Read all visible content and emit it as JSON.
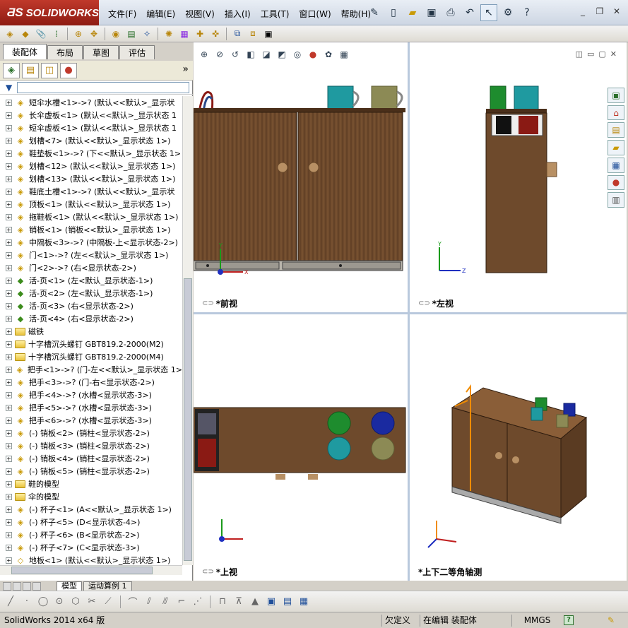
{
  "app": {
    "logo": "SOLIDWORKS",
    "menu": [
      "文件(F)",
      "编辑(E)",
      "视图(V)",
      "插入(I)",
      "工具(T)",
      "窗口(W)",
      "帮助(H)"
    ]
  },
  "left_panel": {
    "tabs": [
      "装配体",
      "布局",
      "草图",
      "评估"
    ],
    "active_tab": "装配体",
    "tree": [
      {
        "type": "asm",
        "label": "短伞水槽<1>->? (默认<<默认>_显示状"
      },
      {
        "type": "asm",
        "label": "长伞虚板<1> (默认<<默认>_显示状态 1"
      },
      {
        "type": "asm",
        "label": "短伞虚板<1> (默认<<默认>_显示状态 1"
      },
      {
        "type": "asm",
        "label": "划槽<7> (默认<<默认>_显示状态 1>)"
      },
      {
        "type": "asm",
        "label": "鞋垫板<1>->? (下<<默认>_显示状态 1>"
      },
      {
        "type": "asm",
        "label": "划槽<12> (默认<<默认>_显示状态 1>)"
      },
      {
        "type": "asm",
        "label": "划槽<13> (默认<<默认>_显示状态 1>)"
      },
      {
        "type": "asm",
        "label": "鞋底土槽<1>->? (默认<<默认>_显示状"
      },
      {
        "type": "asm",
        "label": "顶板<1> (默认<<默认>_显示状态 1>)"
      },
      {
        "type": "asm",
        "label": "拖鞋板<1> (默认<<默认>_显示状态 1>)"
      },
      {
        "type": "asm",
        "label": "销板<1> (销板<<默认>_显示状态 1>)"
      },
      {
        "type": "asm",
        "label": "中隔板<3>->? (中隔板-上<显示状态-2>)"
      },
      {
        "type": "asm",
        "label": "门<1>->? (左<<默认>_显示状态 1>)"
      },
      {
        "type": "asm",
        "label": "门<2>->? (右<显示状态-2>)"
      },
      {
        "type": "mate",
        "label": "活-页<1> (左<默认_显示状态-1>)"
      },
      {
        "type": "mate",
        "label": "活-页<2> (左<默认_显示状态-1>)"
      },
      {
        "type": "mate",
        "label": "活-页<3> (右<显示状态-2>)"
      },
      {
        "type": "mate",
        "label": "活-页<4> (右<显示状态-2>)"
      },
      {
        "type": "folder",
        "label": "磁铁"
      },
      {
        "type": "folder",
        "label": "十字槽沉头螺钉 GBT819.2-2000(M2)"
      },
      {
        "type": "folder",
        "label": "十字槽沉头螺钉 GBT819.2-2000(M4)"
      },
      {
        "type": "asm",
        "label": "把手<1>->? (门-左<<默认>_显示状态 1>"
      },
      {
        "type": "asm",
        "label": "把手<3>->? (门-右<显示状态-2>)"
      },
      {
        "type": "asm",
        "label": "把手<4>->? (水槽<显示状态-3>)"
      },
      {
        "type": "asm",
        "label": "把手<5>->? (水槽<显示状态-3>)"
      },
      {
        "type": "asm",
        "label": "把手<6>->? (水槽<显示状态-3>)"
      },
      {
        "type": "asm",
        "label": "(-) 销板<2> (销柱<显示状态-2>)"
      },
      {
        "type": "asm",
        "label": "(-) 销板<3> (销柱<显示状态-2>)"
      },
      {
        "type": "asm",
        "label": "(-) 销板<4> (销柱<显示状态-2>)"
      },
      {
        "type": "asm",
        "label": "(-) 销板<5> (销柱<显示状态-2>)"
      },
      {
        "type": "folder",
        "label": "鞋的模型"
      },
      {
        "type": "folder",
        "label": "伞的模型"
      },
      {
        "type": "asm",
        "label": "(-) 杯子<1> (A<<默认>_显示状态 1>)"
      },
      {
        "type": "asm",
        "label": "(-) 杯子<5> (D<显示状态-4>)"
      },
      {
        "type": "asm",
        "label": "(-) 杯子<6> (B<显示状态-2>)"
      },
      {
        "type": "asm",
        "label": "(-) 杯子<7> (C<显示状态-3>)"
      },
      {
        "type": "part",
        "label": "地板<1> (默认<<默认>_显示状态 1>)"
      }
    ]
  },
  "viewports": {
    "front": {
      "label": "*前视"
    },
    "left": {
      "label": "*左视"
    },
    "top": {
      "label": "*上视"
    },
    "iso": {
      "label": "*上下二等角轴测"
    }
  },
  "bottom_tabs": [
    "模型",
    "运动算例 1"
  ],
  "status": {
    "version": "SolidWorks 2014 x64 版",
    "defined": "欠定义",
    "editing": "在编辑 装配体",
    "units": "MMGS"
  },
  "colors": {
    "wood": "#6e4a2c",
    "wood_dark": "#4a2f1a",
    "cup_cyan": "#1f9aa0",
    "cup_green": "#1e8c2e",
    "cup_blue": "#1a2aa0",
    "cup_olive": "#8c8a55"
  }
}
